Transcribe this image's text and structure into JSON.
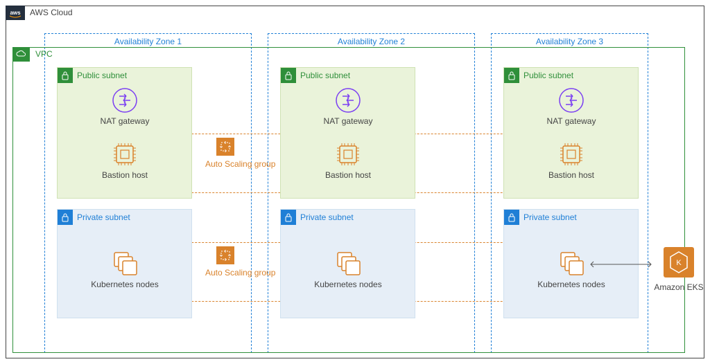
{
  "cloud": {
    "label": "AWS Cloud"
  },
  "vpc": {
    "label": "VPC"
  },
  "az": [
    {
      "label": "Availability Zone 1"
    },
    {
      "label": "Availability Zone 2"
    },
    {
      "label": "Availability Zone 3"
    }
  ],
  "subnets": {
    "public_title": "Public subnet",
    "private_title": "Private subnet"
  },
  "resources": {
    "nat": "NAT gateway",
    "bastion": "Bastion host",
    "k8s": "Kubernetes nodes"
  },
  "asg": {
    "label": "Auto Scaling group"
  },
  "eks": {
    "label": "Amazon EKS"
  },
  "icons": {
    "aws_logo": "aws-logo-icon",
    "vpc": "vpc-cloud-icon",
    "lock": "padlock-icon",
    "nat": "nat-gateway-icon",
    "ec2": "ec2-instance-icon",
    "containers": "containers-icon",
    "asg": "auto-scaling-icon",
    "eks": "eks-service-icon"
  },
  "colors": {
    "az_border": "#1f7fd6",
    "vpc_border": "#2f8f3a",
    "asg": "#d9822b",
    "nat_icon": "#7b3ff2",
    "instance_icon": "#d9822b",
    "public_bg": "#eaf3da",
    "private_bg": "#e6eef7"
  }
}
